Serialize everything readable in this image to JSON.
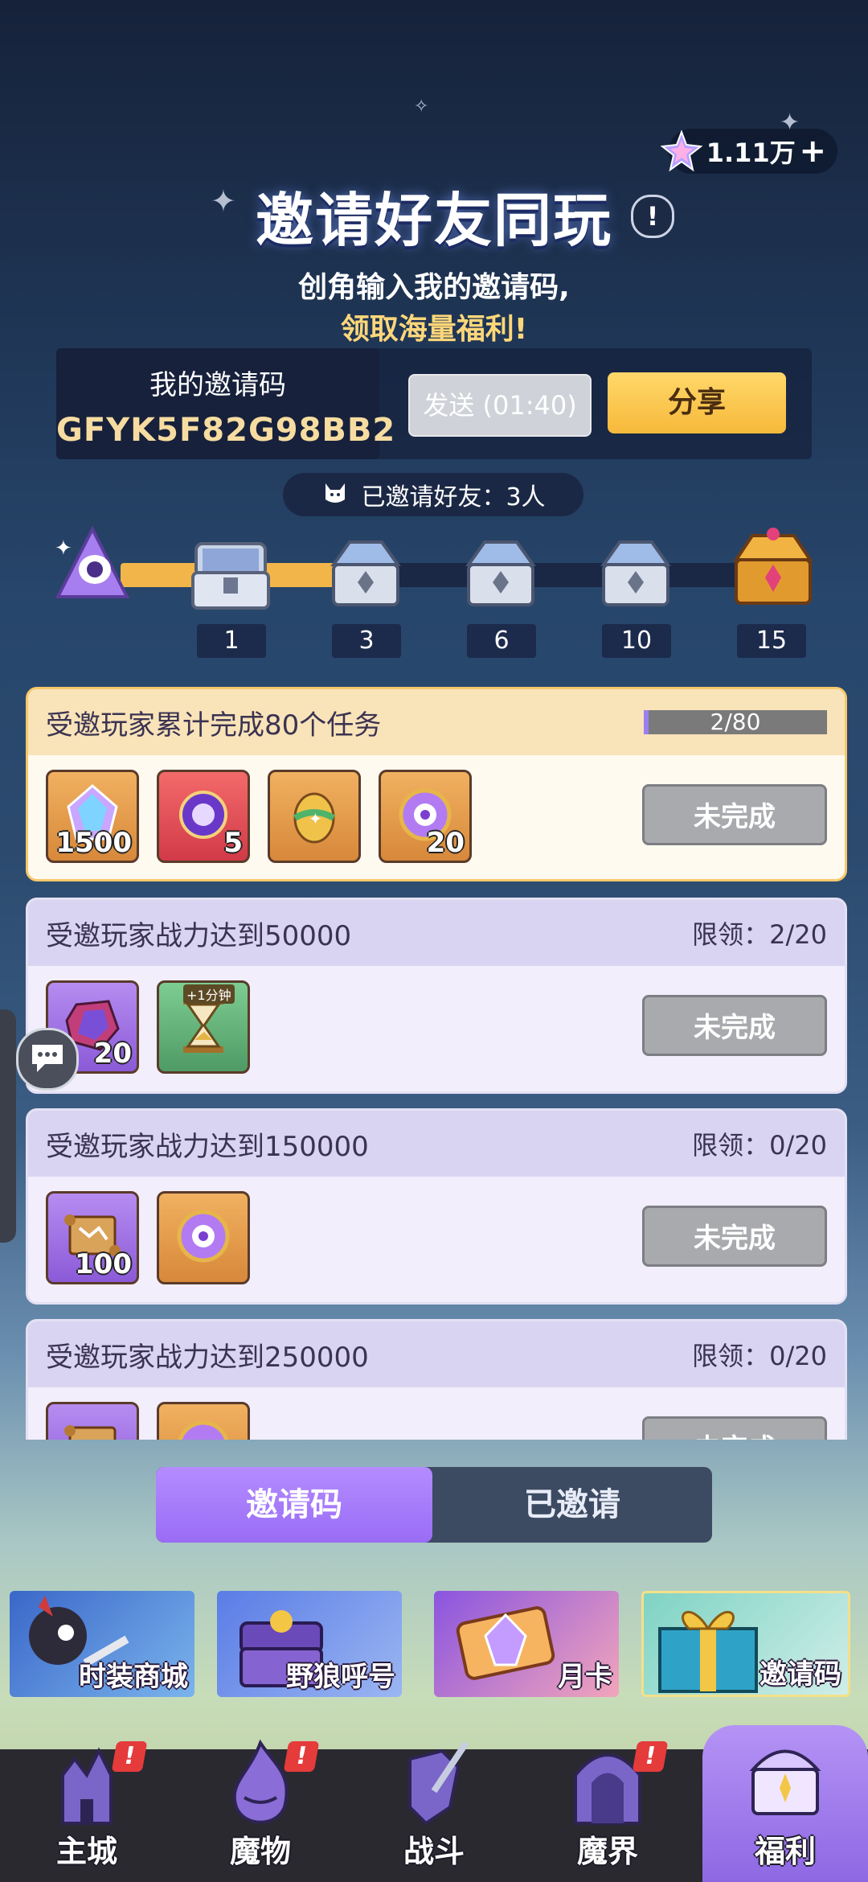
{
  "currency": {
    "amount": "1.11万",
    "plus": "+",
    "icon": "star-crystal-icon"
  },
  "header": {
    "title": "邀请好友同玩",
    "info": "!",
    "subtitle_1": "创角输入我的邀请码,",
    "subtitle_2": "领取海量福利!"
  },
  "invite_code": {
    "label": "我的邀请码",
    "code": "GFYK5F82G98BB2",
    "send_label": "发送 (01:40)",
    "share_label": "分享"
  },
  "invited_count": {
    "text": "已邀请好友：3人"
  },
  "milestones": [
    {
      "num": "1"
    },
    {
      "num": "3"
    },
    {
      "num": "6"
    },
    {
      "num": "10"
    },
    {
      "num": "15"
    }
  ],
  "milestone_progress": 0.2,
  "tasks": [
    {
      "title": "受邀玩家累计完成80个任务",
      "progress_text": "2/80",
      "progress": 0.025,
      "status": "未完成",
      "rewards": [
        {
          "icon": "crystal-icon",
          "qty": "1500"
        },
        {
          "icon": "crystal-box-icon",
          "qty": "5"
        },
        {
          "icon": "egg-icon",
          "qty": ""
        },
        {
          "icon": "rune-coin-icon",
          "qty": "20"
        }
      ]
    },
    {
      "title": "受邀玩家战力达到50000",
      "limit": "限领：2/20",
      "status": "未完成",
      "rewards": [
        {
          "icon": "ore-icon",
          "qty": "20"
        },
        {
          "icon": "hourglass-icon",
          "qty": "",
          "tag": "+1分钟"
        }
      ]
    },
    {
      "title": "受邀玩家战力达到150000",
      "limit": "限领：0/20",
      "status": "未完成",
      "rewards": [
        {
          "icon": "map-scroll-icon",
          "qty": "100"
        },
        {
          "icon": "rune-coin-icon",
          "qty": ""
        }
      ]
    },
    {
      "title": "受邀玩家战力达到250000",
      "limit": "限领：0/20",
      "status": "未完成",
      "rewards": [
        {
          "icon": "map-scroll-icon",
          "qty": ""
        },
        {
          "icon": "rune-coin-icon",
          "qty": ""
        }
      ]
    }
  ],
  "tabs": {
    "active": "邀请码",
    "inactive": "已邀请"
  },
  "shortcuts": [
    {
      "label": "时装商城"
    },
    {
      "label": "野狼呼号"
    },
    {
      "label": "月卡"
    },
    {
      "label": "邀请码"
    }
  ],
  "nav": [
    {
      "label": "主城",
      "badge": "!"
    },
    {
      "label": "魔物",
      "badge": "!"
    },
    {
      "label": "战斗",
      "badge": ""
    },
    {
      "label": "魔界",
      "badge": "!"
    },
    {
      "label": "福利",
      "badge": ""
    }
  ],
  "colors": {
    "accent": "#9a6cf5",
    "share": "#f6b93a",
    "title_gold": "#ffd77a"
  }
}
